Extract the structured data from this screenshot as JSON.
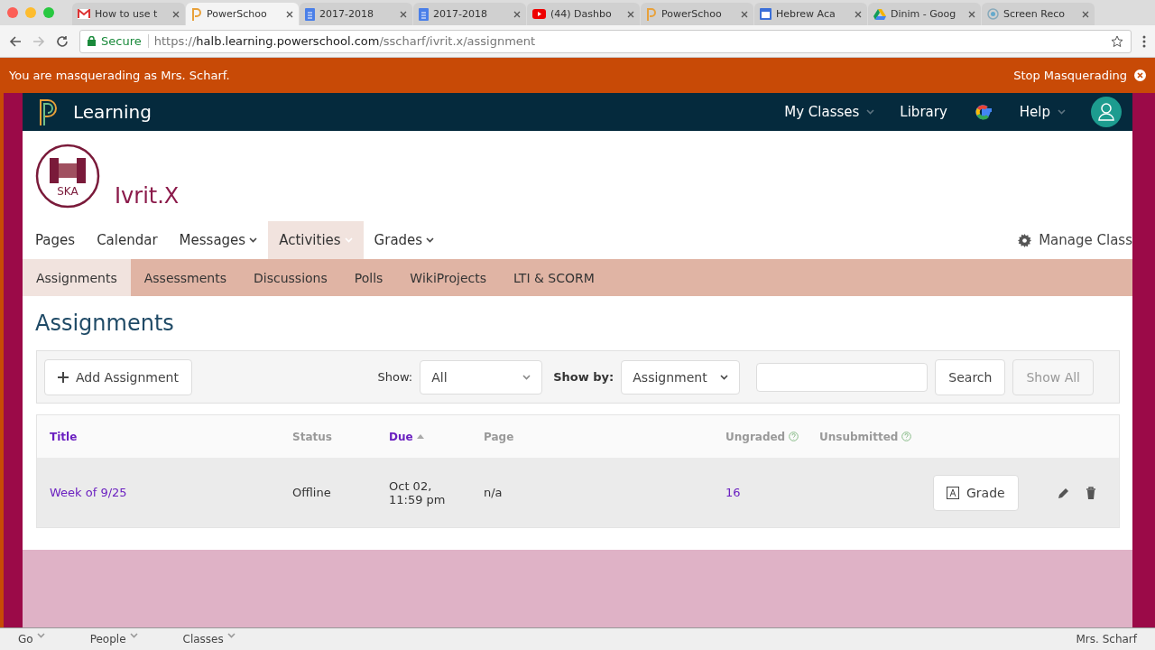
{
  "browser": {
    "tabs": [
      {
        "kind": "mail",
        "title": "How to use t",
        "selected": false
      },
      {
        "kind": "brand",
        "title": "PowerSchoo",
        "selected": true
      },
      {
        "kind": "doc",
        "title": "2017-2018",
        "selected": false
      },
      {
        "kind": "doc",
        "title": "2017-2018",
        "selected": false
      },
      {
        "kind": "video",
        "title": "(44) Dashbo",
        "selected": false
      },
      {
        "kind": "brand",
        "title": "PowerSchoo",
        "selected": false
      },
      {
        "kind": "calendar",
        "title": "Hebrew Aca",
        "selected": false
      },
      {
        "kind": "drive",
        "title": "Dinim - Goog",
        "selected": false
      },
      {
        "kind": "record",
        "title": "Screen Reco",
        "selected": false
      }
    ],
    "secure_label": "Secure",
    "url_scheme": "https://",
    "url_host": "halb.learning.powerschool.com",
    "url_path": "/sscharf/ivrit.x/assignment"
  },
  "banner": {
    "message": "You are masquerading as Mrs. Scharf.",
    "action": "Stop Masquerading"
  },
  "header": {
    "brand": "Learning",
    "nav": [
      {
        "label": "My Classes",
        "dropdown": true
      },
      {
        "label": "Library",
        "dropdown": false
      },
      {
        "label": "Help",
        "dropdown": true
      }
    ]
  },
  "course": {
    "logo_text": "SKA",
    "title": "Ivrit.X"
  },
  "course_nav": [
    {
      "label": "Pages",
      "dropdown": false,
      "selected": false
    },
    {
      "label": "Calendar",
      "dropdown": false,
      "selected": false
    },
    {
      "label": "Messages",
      "dropdown": true,
      "selected": false
    },
    {
      "label": "Activities",
      "dropdown": true,
      "selected": true
    },
    {
      "label": "Grades",
      "dropdown": true,
      "selected": false
    }
  ],
  "manage_class": "Manage Class",
  "sub_tabs": [
    {
      "label": "Assignments",
      "selected": true
    },
    {
      "label": "Assessments",
      "selected": false
    },
    {
      "label": "Discussions",
      "selected": false
    },
    {
      "label": "Polls",
      "selected": false
    },
    {
      "label": "WikiProjects",
      "selected": false
    },
    {
      "label": "LTI & SCORM",
      "selected": false
    }
  ],
  "page_title": "Assignments",
  "toolbar": {
    "add_button": "Add Assignment",
    "show_label": "Show:",
    "show_value": "All",
    "show_by_label": "Show by:",
    "show_by_value": "Assignment",
    "search_button": "Search",
    "show_all": {
      "label": "Show All",
      "disabled": true
    }
  },
  "table": {
    "columns": [
      {
        "label": "Title",
        "sortable": true,
        "sorted": false,
        "help": false
      },
      {
        "label": "Status",
        "sortable": false,
        "sorted": false,
        "help": false
      },
      {
        "label": "Due",
        "sortable": true,
        "sorted": true,
        "help": false
      },
      {
        "label": "Page",
        "sortable": false,
        "sorted": false,
        "help": false
      },
      {
        "label": "Ungraded",
        "sortable": false,
        "sorted": false,
        "help": true
      },
      {
        "label": "Unsubmitted",
        "sortable": false,
        "sorted": false,
        "help": true
      }
    ],
    "rows": [
      {
        "title": "Week of 9/25",
        "status": "Offline",
        "due": [
          "Oct 02,",
          "11:59 pm"
        ],
        "page": "n/a",
        "ungraded": "16",
        "grade_button": "Grade"
      }
    ]
  },
  "bottom_bar": {
    "items": [
      "Go",
      "People",
      "Classes"
    ],
    "user": "Mrs. Scharf"
  }
}
